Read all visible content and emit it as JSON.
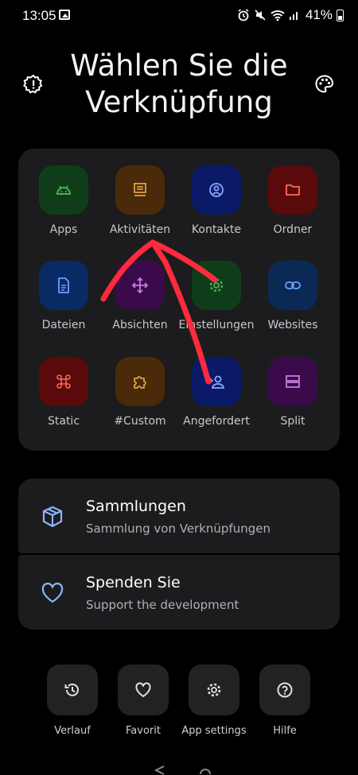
{
  "status_bar": {
    "time": "13:05",
    "battery": "41%"
  },
  "header": {
    "title_line1": "Wählen Sie die",
    "title_line2": "Verknüpfung",
    "left_icon": "gear-alert-icon",
    "right_icon": "palette-icon"
  },
  "grid": {
    "tiles": [
      {
        "label": "Apps",
        "icon": "android-icon",
        "bg": "#0f3d1a",
        "fg": "#4caf50"
      },
      {
        "label": "Aktivitäten",
        "icon": "activity-icon",
        "bg": "#4a2a08",
        "fg": "#e0a04a"
      },
      {
        "label": "Kontakte",
        "icon": "contact-icon",
        "bg": "#0a1a66",
        "fg": "#8ea6ff"
      },
      {
        "label": "Ordner",
        "icon": "folder-icon",
        "bg": "#5a0a0a",
        "fg": "#ff6a5a"
      },
      {
        "label": "Dateien",
        "icon": "file-icon",
        "bg": "#0a2a66",
        "fg": "#6aa0ff"
      },
      {
        "label": "Absichten",
        "icon": "intent-icon",
        "bg": "#3a0a4a",
        "fg": "#c87ae0"
      },
      {
        "label": "Einstellungen",
        "icon": "settings-icon",
        "bg": "#0f3d1a",
        "fg": "#4caf50"
      },
      {
        "label": "Websites",
        "icon": "link-icon",
        "bg": "#0a2a55",
        "fg": "#6aa0ff"
      },
      {
        "label": "Static",
        "icon": "command-icon",
        "bg": "#5a0a0a",
        "fg": "#ff6a5a"
      },
      {
        "label": "#Custom",
        "icon": "puzzle-icon",
        "bg": "#4a2a08",
        "fg": "#e0a04a"
      },
      {
        "label": "Angefordert",
        "icon": "person-add-icon",
        "bg": "#0a1a66",
        "fg": "#8ea6ff"
      },
      {
        "label": "Split",
        "icon": "split-icon",
        "bg": "#3a0a4a",
        "fg": "#c87ae0"
      }
    ]
  },
  "cards": [
    {
      "title": "Sammlungen",
      "subtitle": "Sammlung von Verknüpfungen",
      "icon": "box-icon"
    },
    {
      "title": "Spenden Sie",
      "subtitle": "Support the development",
      "icon": "heart-icon"
    }
  ],
  "actions": [
    {
      "label": "Verlauf",
      "icon": "history-icon"
    },
    {
      "label": "Favorit",
      "icon": "heart-icon"
    },
    {
      "label": "App settings",
      "icon": "settings-icon"
    },
    {
      "label": "Hilfe",
      "icon": "help-icon"
    }
  ],
  "colors": {
    "background": "#000000",
    "panel": "#1c1c1e",
    "accent_blue": "#8ab4f8",
    "annotation_red": "#ff2a3c"
  }
}
